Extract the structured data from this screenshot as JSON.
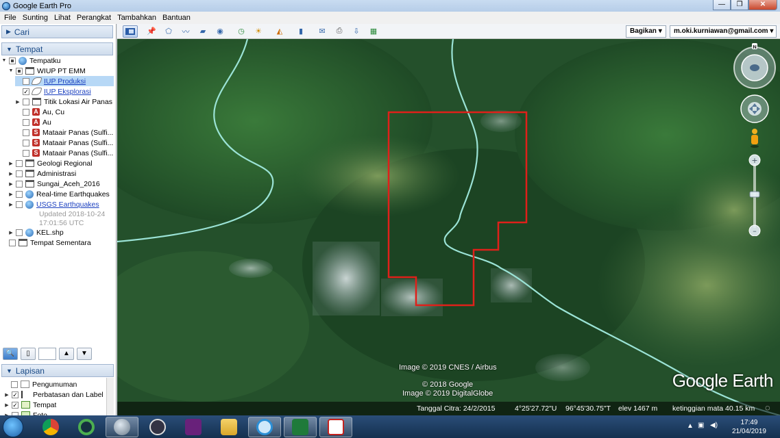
{
  "window": {
    "title": "Google Earth Pro"
  },
  "menu": [
    "File",
    "Sunting",
    "Lihat",
    "Perangkat",
    "Tambahkan",
    "Bantuan"
  ],
  "search_panel": {
    "label": "Cari"
  },
  "places_panel": {
    "label": "Tempat",
    "items": [
      {
        "label": "Tempatku"
      },
      {
        "label": "WIUP PT EMM"
      },
      {
        "label": "IUP Produksi"
      },
      {
        "label": "IUP Eksplorasi"
      },
      {
        "label": "Titik Lokasi Air Panas"
      },
      {
        "label": "Au, Cu",
        "icon_text": "A"
      },
      {
        "label": "Au",
        "icon_text": "A"
      },
      {
        "label": "Mataair Panas (Sulfi...",
        "icon_text": "S"
      },
      {
        "label": "Mataair Panas (Sulfi...",
        "icon_text": "S"
      },
      {
        "label": "Mataair Panas (Sulfi...",
        "icon_text": "S"
      },
      {
        "label": "Geologi Regional"
      },
      {
        "label": "Administrasi"
      },
      {
        "label": "Sungai_Aceh_2016"
      },
      {
        "label": "Real-time Earthquakes"
      },
      {
        "label": "USGS Earthquakes"
      },
      {
        "label": "Updated 2018-10-24"
      },
      {
        "label": "17:01:56 UTC"
      },
      {
        "label": "KEL.shp"
      },
      {
        "label": "Tempat Sementara"
      }
    ]
  },
  "layers_panel": {
    "label": "Lapisan",
    "items": [
      {
        "label": "Pengumuman"
      },
      {
        "label": "Perbatasan dan Label"
      },
      {
        "label": "Tempat"
      },
      {
        "label": "Foto"
      }
    ]
  },
  "toolbar": {
    "share": "Bagikan",
    "account": "m.oki.kurniawan@gmail.com"
  },
  "map": {
    "attribution1": "Image © 2019 CNES / Airbus",
    "attribution2": "© 2018 Google",
    "attribution3": "Image © 2019 DigitalGlobe",
    "logo": "Google Earth",
    "compass_n": "N",
    "status": {
      "imagery_date": "Tanggal Citra: 24/2/2015",
      "lat": "4°25'27.72\"U",
      "lon": "96°45'30.75\"T",
      "elev": "elev  1467 m",
      "eye_alt": "ketinggian mata  40.15 km"
    },
    "colors": {
      "boundary": "#e0201a",
      "river": "#9be3d6"
    }
  },
  "taskbar": {
    "time": "17:49",
    "date": "21/04/2019"
  }
}
